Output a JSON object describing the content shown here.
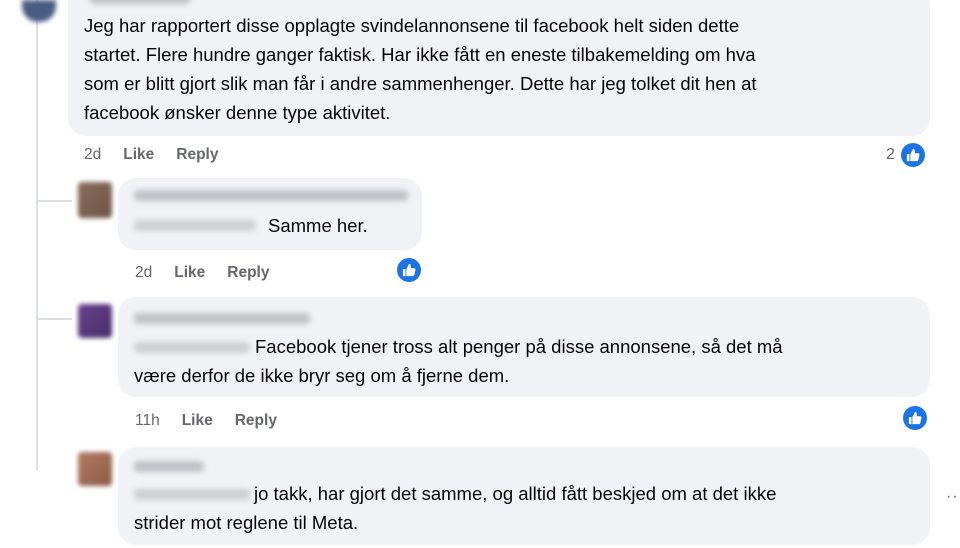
{
  "comments": [
    {
      "author": "",
      "lines": [
        "Jeg har rapportert disse opplagte svindelannonsene til facebook helt siden dette",
        "startet. Flere hundre ganger faktisk. Har ikke fått en eneste tilbakemelding om hva",
        "som er blitt gjort slik man får i andre sammenhenger. Dette har jeg tolket dit hen at",
        "facebook ønsker denne type aktivitet."
      ],
      "time": "2d",
      "like_label": "Like",
      "reply_label": "Reply",
      "reactions": "2"
    },
    {
      "author": "",
      "lines": [
        "Samme her."
      ],
      "time": "2d",
      "like_label": "Like",
      "reply_label": "Reply"
    },
    {
      "author": "",
      "lines": [
        "Facebook tjener tross alt penger på disse annonsene, så det må",
        "være derfor de ikke bryr seg om å fjerne dem."
      ],
      "time": "11h",
      "like_label": "Like",
      "reply_label": "Reply"
    },
    {
      "author": "",
      "lines": [
        "jo takk, har gjort det samme, og alltid fått beskjed om at det ikke",
        "strider mot reglene til Meta."
      ]
    }
  ],
  "more_icon": "more-horizontal-icon",
  "colors": {
    "like_blue": "#1b74e4",
    "bubble": "#f0f2f5",
    "meta": "#65676b"
  }
}
